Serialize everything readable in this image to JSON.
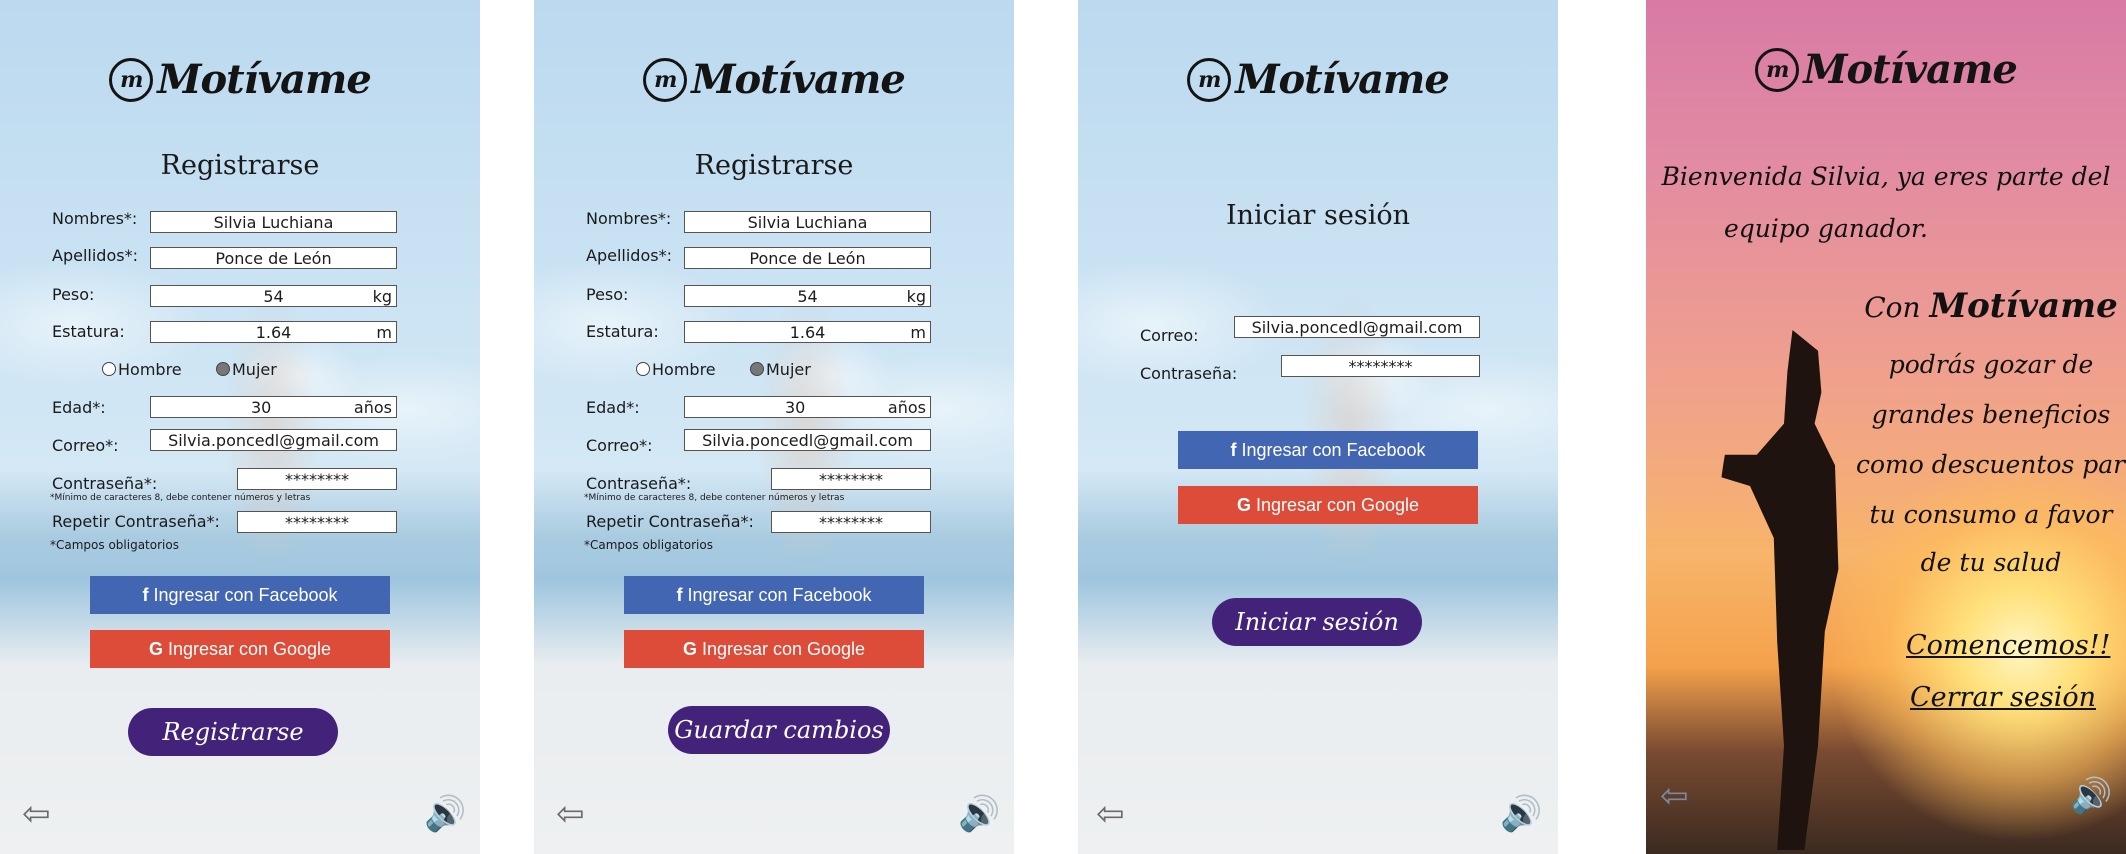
{
  "app": {
    "logo_text": "Motívame",
    "logo_icon": "m"
  },
  "screen1": {
    "title": "Registrarse",
    "labels": {
      "nombres": "Nombres*:",
      "apellidos": "Apellidos*:",
      "peso": "Peso:",
      "estatura": "Estatura:",
      "edad": "Edad*:",
      "correo": "Correo*:",
      "contrasena": "Contraseña*:",
      "repetir": "Repetir Contraseña*:"
    },
    "values": {
      "nombres": "Silvia Luchiana",
      "apellidos": "Ponce de León",
      "peso": "54",
      "peso_unit": "kg",
      "estatura": "1.64",
      "estatura_unit": "m",
      "edad": "30",
      "edad_unit": "años",
      "correo": "Silvia.poncedl@gmail.com",
      "contrasena": "********",
      "repetir": "********"
    },
    "gender": {
      "male": "Hombre",
      "female": "Mujer",
      "selected": "female"
    },
    "password_hint": "*Mínimo de caracteres 8, debe contener números y letras",
    "required_note": "*Campos obligatorios",
    "facebook": "Ingresar con Facebook",
    "google": "Ingresar con Google",
    "submit": "Registrarse"
  },
  "screen2": {
    "title": "Registrarse",
    "submit": "Guardar cambios"
  },
  "screen3": {
    "title": "Iniciar sesión",
    "labels": {
      "correo": "Correo:",
      "contrasena": "Contraseña:"
    },
    "values": {
      "correo": "Silvia.poncedl@gmail.com",
      "contrasena": "********"
    },
    "facebook": "Ingresar con Facebook",
    "google": "Ingresar con Google",
    "submit": "Iniciar sesión"
  },
  "screen4": {
    "welcome_line1": "Bienvenida Silvia, ya eres parte  del",
    "welcome_line2": "equipo ganador.",
    "con": "Con",
    "brand": "Motívame",
    "benefits": [
      "podrás gozar de",
      "grandes beneficios",
      "como descuentos para",
      "tu consumo a favor",
      "de tu salud"
    ],
    "start": "Comencemos!!",
    "logout": "Cerrar sesión"
  },
  "icons": {
    "back": "back-arrow-icon",
    "sound": "speaker-icon"
  }
}
